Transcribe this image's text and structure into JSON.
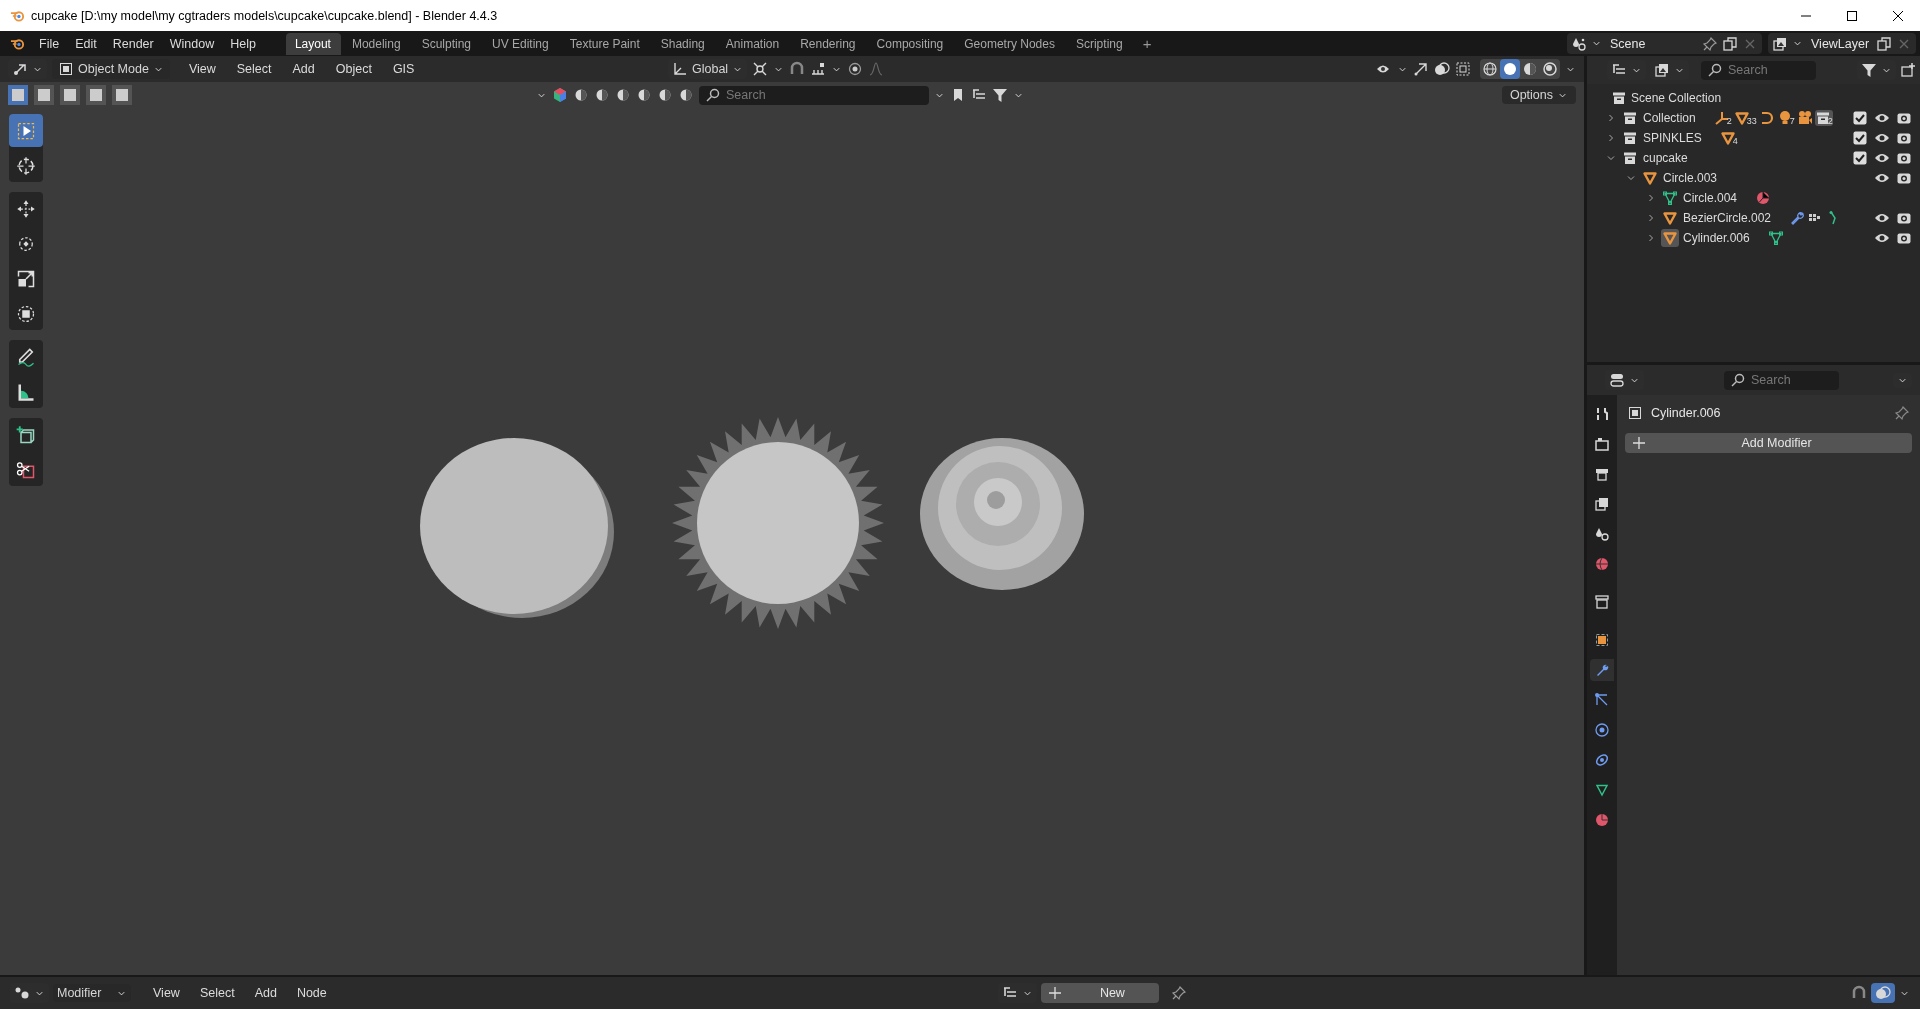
{
  "window": {
    "title": "cupcake [D:\\my model\\my cgtraders models\\cupcake\\cupcake.blend] - Blender 4.4.3"
  },
  "menu_bar": [
    "File",
    "Edit",
    "Render",
    "Window",
    "Help"
  ],
  "workspace_tabs": [
    {
      "label": "Layout",
      "selected": true
    },
    {
      "label": "Modeling",
      "selected": false
    },
    {
      "label": "Sculpting",
      "selected": false
    },
    {
      "label": "UV Editing",
      "selected": false
    },
    {
      "label": "Texture Paint",
      "selected": false
    },
    {
      "label": "Shading",
      "selected": false
    },
    {
      "label": "Animation",
      "selected": false
    },
    {
      "label": "Rendering",
      "selected": false
    },
    {
      "label": "Compositing",
      "selected": false
    },
    {
      "label": "Geometry Nodes",
      "selected": false
    },
    {
      "label": "Scripting",
      "selected": false
    }
  ],
  "add_workspace": "+",
  "scene": {
    "name": "Scene"
  },
  "view_layer": {
    "name": "ViewLayer"
  },
  "viewport_header": {
    "mode": "Object Mode",
    "menus": [
      "View",
      "Select",
      "Add",
      "Object",
      "GIS"
    ],
    "orientation": "Global",
    "search": {
      "placeholder": "Search"
    },
    "options": "Options",
    "select_modes": [
      {
        "selected": true
      },
      {
        "selected": false
      },
      {
        "selected": false
      },
      {
        "selected": false
      },
      {
        "selected": false
      }
    ],
    "shading_modes": [
      {
        "kind": "wireframe",
        "selected": false
      },
      {
        "kind": "solid",
        "selected": true
      },
      {
        "kind": "material",
        "selected": false
      },
      {
        "kind": "rendered",
        "selected": false
      }
    ]
  },
  "toolbar": {
    "groups": [
      {
        "tools": [
          {
            "kind": "select_box",
            "selected": true
          },
          {
            "kind": "cursor",
            "selected": false
          }
        ]
      },
      {
        "tools": [
          {
            "kind": "move",
            "selected": false
          },
          {
            "kind": "rotate",
            "selected": false
          },
          {
            "kind": "scale",
            "selected": false
          },
          {
            "kind": "transform",
            "selected": false
          }
        ]
      },
      {
        "tools": [
          {
            "kind": "annotate",
            "selected": false
          },
          {
            "kind": "measure",
            "selected": false
          }
        ]
      },
      {
        "tools": [
          {
            "kind": "add_cube",
            "selected": false
          },
          {
            "kind": "cut",
            "selected": false
          }
        ]
      }
    ]
  },
  "viewport": {
    "kind": "picture"
  },
  "outliner": {
    "search": {
      "placeholder": "Search"
    },
    "root": "Scene Collection",
    "items": [
      {
        "name": "Collection",
        "kind": "collection",
        "expanded": false,
        "checked": true,
        "toggles": true,
        "badges": [
          {
            "kind": "empty",
            "count": "2"
          },
          {
            "kind": "object",
            "count": "33"
          },
          {
            "kind": "curve"
          },
          {
            "kind": "light",
            "count": "7"
          },
          {
            "kind": "camera"
          },
          {
            "kind": "collection",
            "count": "2"
          }
        ]
      },
      {
        "name": "SPINKLES",
        "kind": "collection",
        "expanded": false,
        "checked": true,
        "toggles": true,
        "badges": [
          {
            "kind": "object",
            "count": "4"
          }
        ]
      },
      {
        "name": "cupcake",
        "kind": "collection",
        "expanded": true,
        "checked": true,
        "toggles": true,
        "children": [
          {
            "name": "Circle.003",
            "kind": "object",
            "expanded": true,
            "active": false,
            "toggles": true,
            "children": [
              {
                "name": "Circle.004",
                "kind": "mesh",
                "expanded": false,
                "active": false,
                "toggles": false,
                "badges": [
                  {
                    "kind": "material"
                  }
                ]
              },
              {
                "name": "BezierCircle.002",
                "kind": "object",
                "expanded": false,
                "active": false,
                "toggles": true,
                "badges": [
                  {
                    "kind": "modifier"
                  },
                  {
                    "kind": "particles"
                  },
                  {
                    "kind": "hook"
                  }
                ]
              },
              {
                "name": "Cylinder.006",
                "kind": "object",
                "expanded": false,
                "active": true,
                "toggles": true,
                "badges": [
                  {
                    "kind": "mesh"
                  }
                ]
              }
            ]
          }
        ]
      }
    ]
  },
  "properties": {
    "search": {
      "placeholder": "Search"
    },
    "object_name": "Cylinder.006",
    "add_modifier": "Add Modifier",
    "tabs": [
      {
        "kind": "tool",
        "selected": false
      },
      {
        "kind": "render",
        "selected": false
      },
      {
        "kind": "output",
        "selected": false
      },
      {
        "kind": "view_layer",
        "selected": false
      },
      {
        "kind": "scene",
        "selected": false
      },
      {
        "kind": "world",
        "selected": false
      },
      {
        "kind": "collection",
        "selected": false
      },
      {
        "kind": "object",
        "selected": false
      },
      {
        "kind": "modifier",
        "selected": true
      },
      {
        "kind": "particles",
        "selected": false
      },
      {
        "kind": "physics",
        "selected": false
      },
      {
        "kind": "constraints",
        "selected": false
      },
      {
        "kind": "data",
        "selected": false
      },
      {
        "kind": "material",
        "selected": false
      }
    ]
  },
  "bottom_bar": {
    "editor": "Modifier",
    "menus": [
      "View",
      "Select",
      "Add",
      "Node"
    ],
    "new_button": "New"
  }
}
